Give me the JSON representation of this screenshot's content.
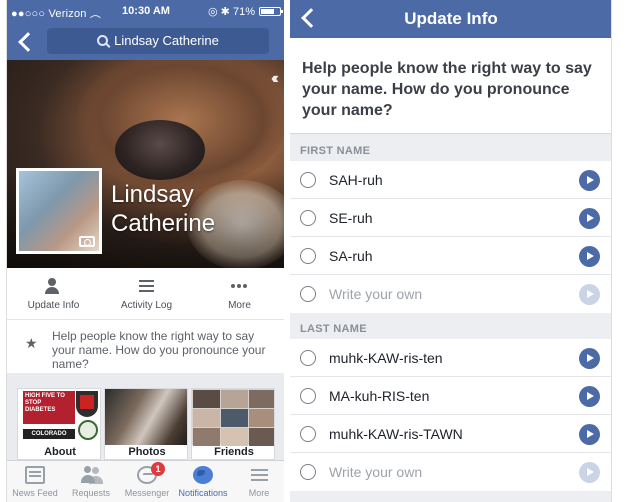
{
  "left_phone": {
    "status_bar": {
      "carrier": "Verizon",
      "time": "10:30 AM",
      "battery": "71%",
      "battery_level": 0.71
    },
    "search": {
      "text": "Lindsay Catherine"
    },
    "profile": {
      "name_line1": "Lindsay",
      "name_line2": "Catherine"
    },
    "actions": [
      {
        "label": "Update Info",
        "icon": "person-edit-icon"
      },
      {
        "label": "Activity Log",
        "icon": "list-icon"
      },
      {
        "label": "More",
        "icon": "more-dots-icon"
      }
    ],
    "hint": {
      "icon": "star-icon",
      "text": "Help people know the right way to say your name. How do you pronounce your name?"
    },
    "tiles": [
      {
        "label": "About",
        "about_badge_text": "HIGH FIVE TO STOP DIABETES",
        "about_caption": "COLORADO"
      },
      {
        "label": "Photos"
      },
      {
        "label": "Friends"
      }
    ],
    "tab_bar": [
      {
        "label": "News Feed",
        "icon": "news-feed-icon"
      },
      {
        "label": "Requests",
        "icon": "friend-requests-icon"
      },
      {
        "label": "Messenger",
        "icon": "messenger-icon",
        "badge": "1"
      },
      {
        "label": "Notifications",
        "icon": "globe-icon",
        "active": true
      },
      {
        "label": "More",
        "icon": "hamburger-icon"
      }
    ]
  },
  "right_phone": {
    "header": {
      "title": "Update Info"
    },
    "question": "Help people know the right way to say your name. How do you pronounce your name?",
    "first_name": {
      "section_label": "FIRST NAME",
      "options": [
        "SAH-ruh",
        "SE-ruh",
        "SA-ruh"
      ],
      "write_own_placeholder": "Write your own"
    },
    "last_name": {
      "section_label": "LAST NAME",
      "options": [
        "muhk-KAW-ris-ten",
        "MA-kuh-RIS-ten",
        "muhk-KAW-ris-TAWN"
      ],
      "write_own_placeholder": "Write your own"
    },
    "colors": {
      "brand_blue": "#4b6aa6",
      "badge_red": "#e0393e"
    }
  }
}
